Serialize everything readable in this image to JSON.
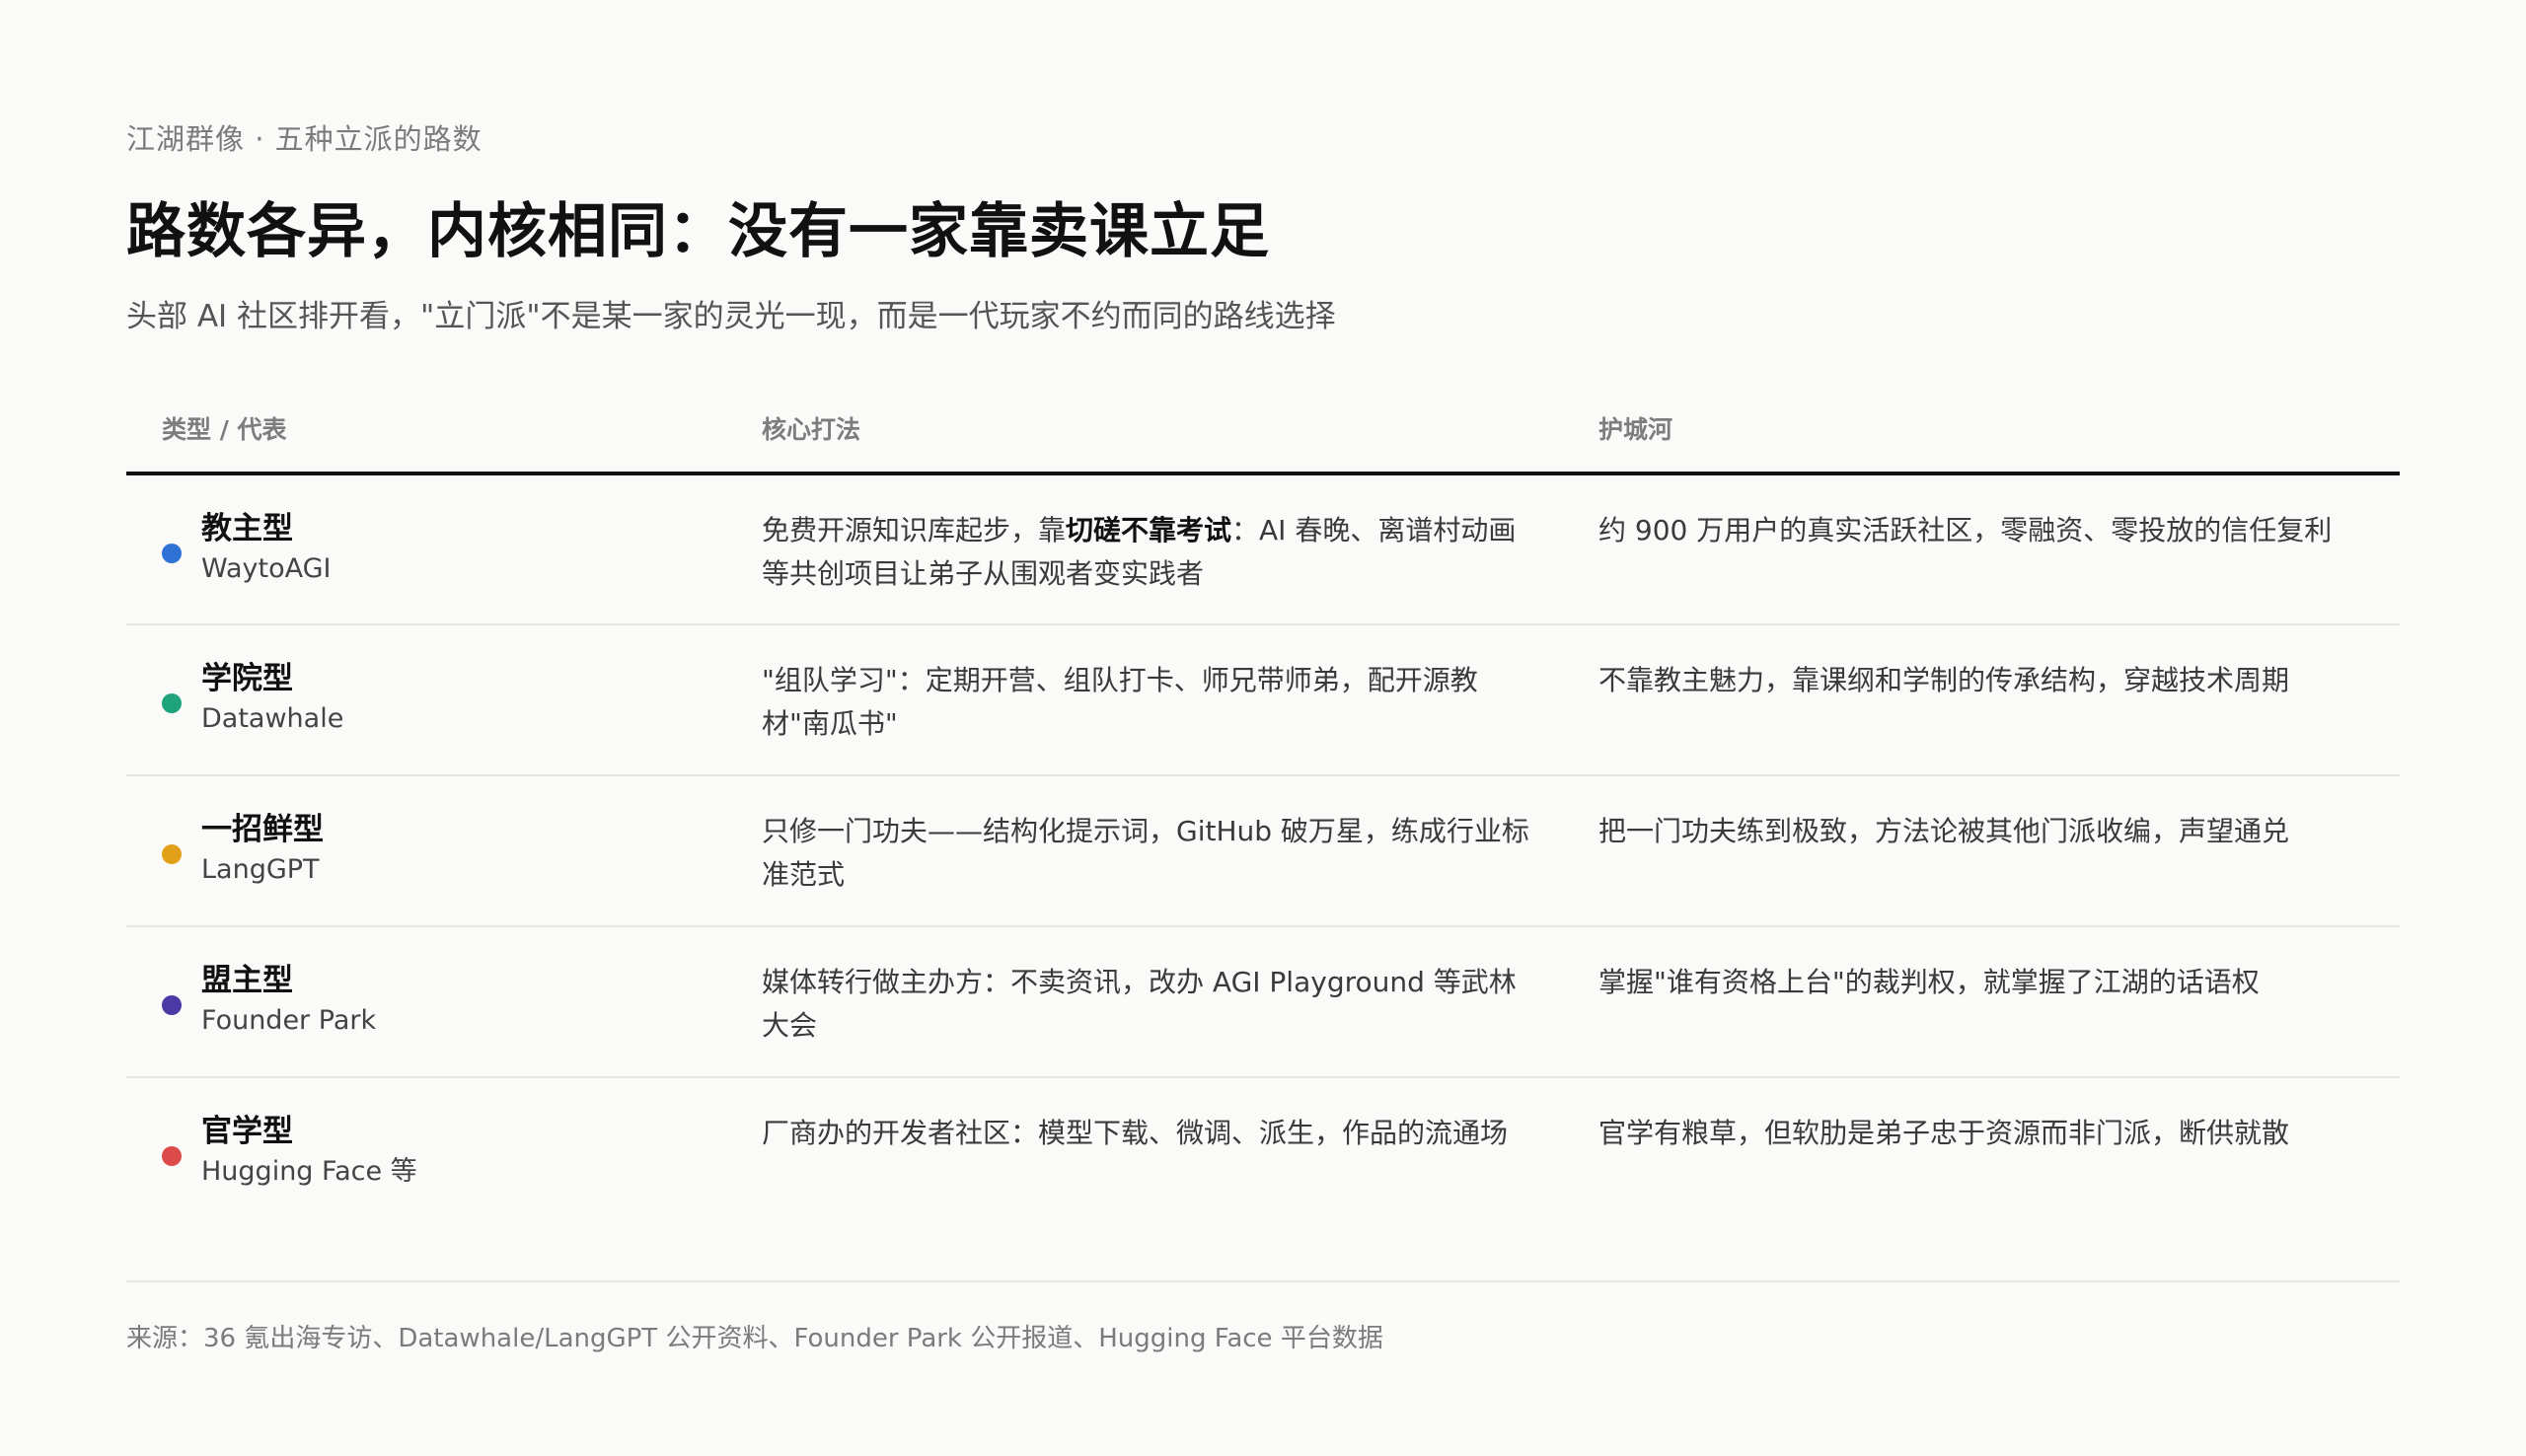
{
  "eyebrow": "江湖群像 · 五种立派的路数",
  "title": "路数各异，内核相同：没有一家靠卖课立足",
  "subtitle": "头部 AI 社区排开看，\"立门派\"不是某一家的灵光一现，而是一代玩家不约而同的路线选择",
  "table": {
    "headers": [
      "类型 / 代表",
      "核心打法",
      "护城河"
    ],
    "rows": [
      {
        "type": "教主型",
        "rep": "WaytoAGI",
        "color": "#2f72d6",
        "strategy_pre": "免费开源知识库起步，靠",
        "strategy_kw": "切磋不靠考试",
        "strategy_post": "：AI 春晚、离谱村动画等共创项目让弟子从围观者变实践者",
        "moat": "约 900 万用户的真实活跃社区，零融资、零投放的信任复利"
      },
      {
        "type": "学院型",
        "rep": "Datawhale",
        "color": "#1fa37a",
        "strategy_pre": "\"组队学习\"：定期开营、组队打卡、师兄带师弟，配开源教材\"南瓜书\"",
        "strategy_kw": "",
        "strategy_post": "",
        "moat": "不靠教主魅力，靠课纲和学制的传承结构，穿越技术周期"
      },
      {
        "type": "一招鲜型",
        "rep": "LangGPT",
        "color": "#e3a11a",
        "strategy_pre": "只修一门功夫——结构化提示词，GitHub 破万星，练成行业标准范式",
        "strategy_kw": "",
        "strategy_post": "",
        "moat": "把一门功夫练到极致，方法论被其他门派收编，声望通兑"
      },
      {
        "type": "盟主型",
        "rep": "Founder Park",
        "color": "#4b3aa6",
        "strategy_pre": "媒体转行做主办方：不卖资讯，改办 AGI Playground 等武林大会",
        "strategy_kw": "",
        "strategy_post": "",
        "moat": "掌握\"谁有资格上台\"的裁判权，就掌握了江湖的话语权"
      },
      {
        "type": "官学型",
        "rep": "Hugging Face 等",
        "color": "#dc4a4a",
        "strategy_pre": "厂商办的开发者社区：模型下载、微调、派生，作品的流通场",
        "strategy_kw": "",
        "strategy_post": "",
        "moat": "官学有粮草，但软肋是弟子忠于资源而非门派，断供就散"
      }
    ]
  },
  "source": "来源：36 氪出海专访、Datawhale/LangGPT 公开资料、Founder Park 公开报道、Hugging Face 平台数据"
}
